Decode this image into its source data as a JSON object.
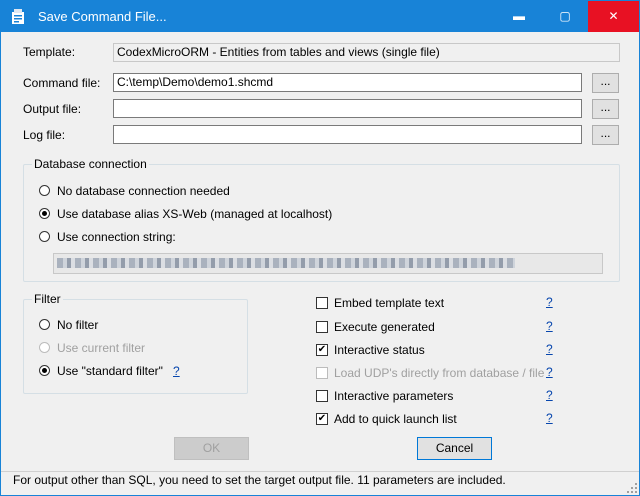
{
  "window": {
    "title": "Save Command File...",
    "min_glyph": "▬",
    "max_glyph": "▢",
    "close_glyph": "✕",
    "accent": "#1883d7",
    "close_color": "#e81123"
  },
  "form": {
    "template_label": "Template:",
    "template_value": "CodexMicroORM - Entities from tables and views (single file)",
    "command_label": "Command file:",
    "command_value": "C:\\temp\\Demo\\demo1.shcmd",
    "output_label": "Output file:",
    "output_value": "",
    "log_label": "Log file:",
    "log_value": "",
    "browse_label": "..."
  },
  "db": {
    "title": "Database connection",
    "opt1": "No database connection needed",
    "opt2": "Use database alias XS-Web (managed at localhost)",
    "opt3": "Use connection string:",
    "selected": 2
  },
  "filter": {
    "title": "Filter",
    "opt1": "No filter",
    "opt2": "Use current filter",
    "opt3": "Use \"standard filter\"",
    "help": "?"
  },
  "options": [
    {
      "label": "Embed template text",
      "checked": false,
      "enabled": true,
      "help": "?"
    },
    {
      "label": "Execute generated",
      "checked": false,
      "enabled": true,
      "help": "?"
    },
    {
      "label": "Interactive status",
      "checked": true,
      "enabled": true,
      "help": "?"
    },
    {
      "label": "Load UDP's directly from database / file",
      "checked": false,
      "enabled": false,
      "help": "?"
    },
    {
      "label": "Interactive parameters",
      "checked": false,
      "enabled": true,
      "help": "?"
    },
    {
      "label": "Add to quick launch list",
      "checked": true,
      "enabled": true,
      "help": "?"
    }
  ],
  "buttons": {
    "ok": "OK",
    "cancel": "Cancel"
  },
  "status": "For output other than SQL, you need to set the target output file. 11 parameters are included.",
  "check_glyph": "✔"
}
